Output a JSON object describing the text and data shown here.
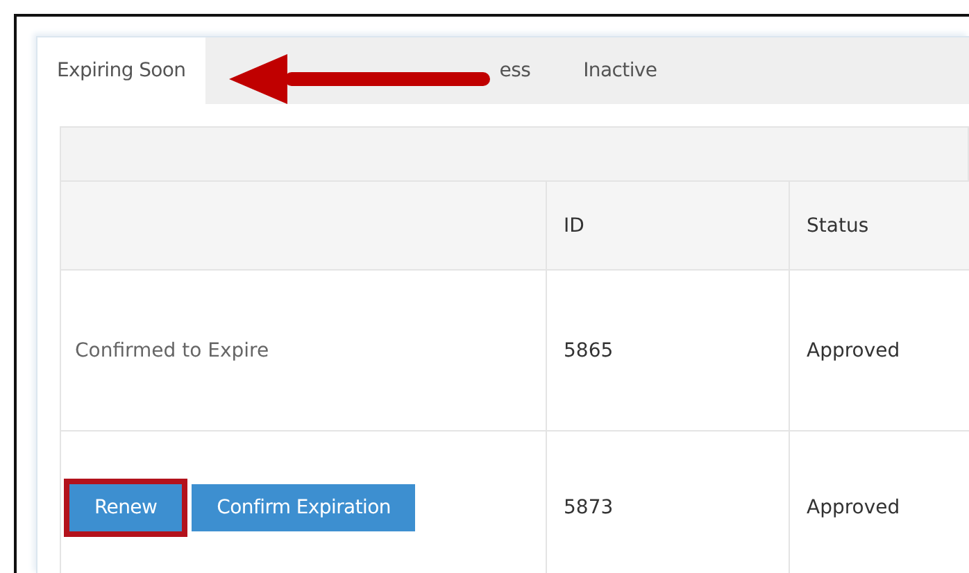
{
  "tabs": [
    {
      "label": "Expiring Soon",
      "selected": true
    },
    {
      "label": "ess",
      "selected": false
    },
    {
      "label": "Inactive",
      "selected": false
    }
  ],
  "table": {
    "columns": [
      "ID",
      "Status"
    ],
    "rows": [
      {
        "kind": "text",
        "action": "Confirmed to Expire",
        "id": "5865",
        "status": "Approved"
      },
      {
        "kind": "buttons",
        "buttons": [
          {
            "label": "Renew",
            "highlighted": true
          },
          {
            "label": "Confirm Expiration",
            "highlighted": false
          }
        ],
        "id": "5873",
        "status": "Approved"
      }
    ]
  }
}
